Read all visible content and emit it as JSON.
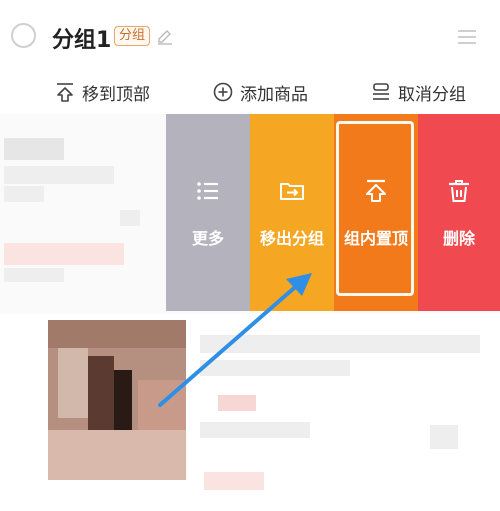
{
  "header": {
    "group_name": "分组1",
    "group_tag": "分组"
  },
  "actions": {
    "move_to_top": "移到顶部",
    "add_product": "添加商品",
    "ungroup": "取消分组"
  },
  "swipe_buttons": {
    "more": "更多",
    "move_out": "移出分组",
    "pin_in_group": "组内置顶",
    "delete": "删除"
  },
  "colors": {
    "more": "#b3b2bd",
    "move_out": "#f5a623",
    "pin_in_group": "#f27a1a",
    "delete": "#f04a50",
    "arrow": "#2f8fe6"
  }
}
